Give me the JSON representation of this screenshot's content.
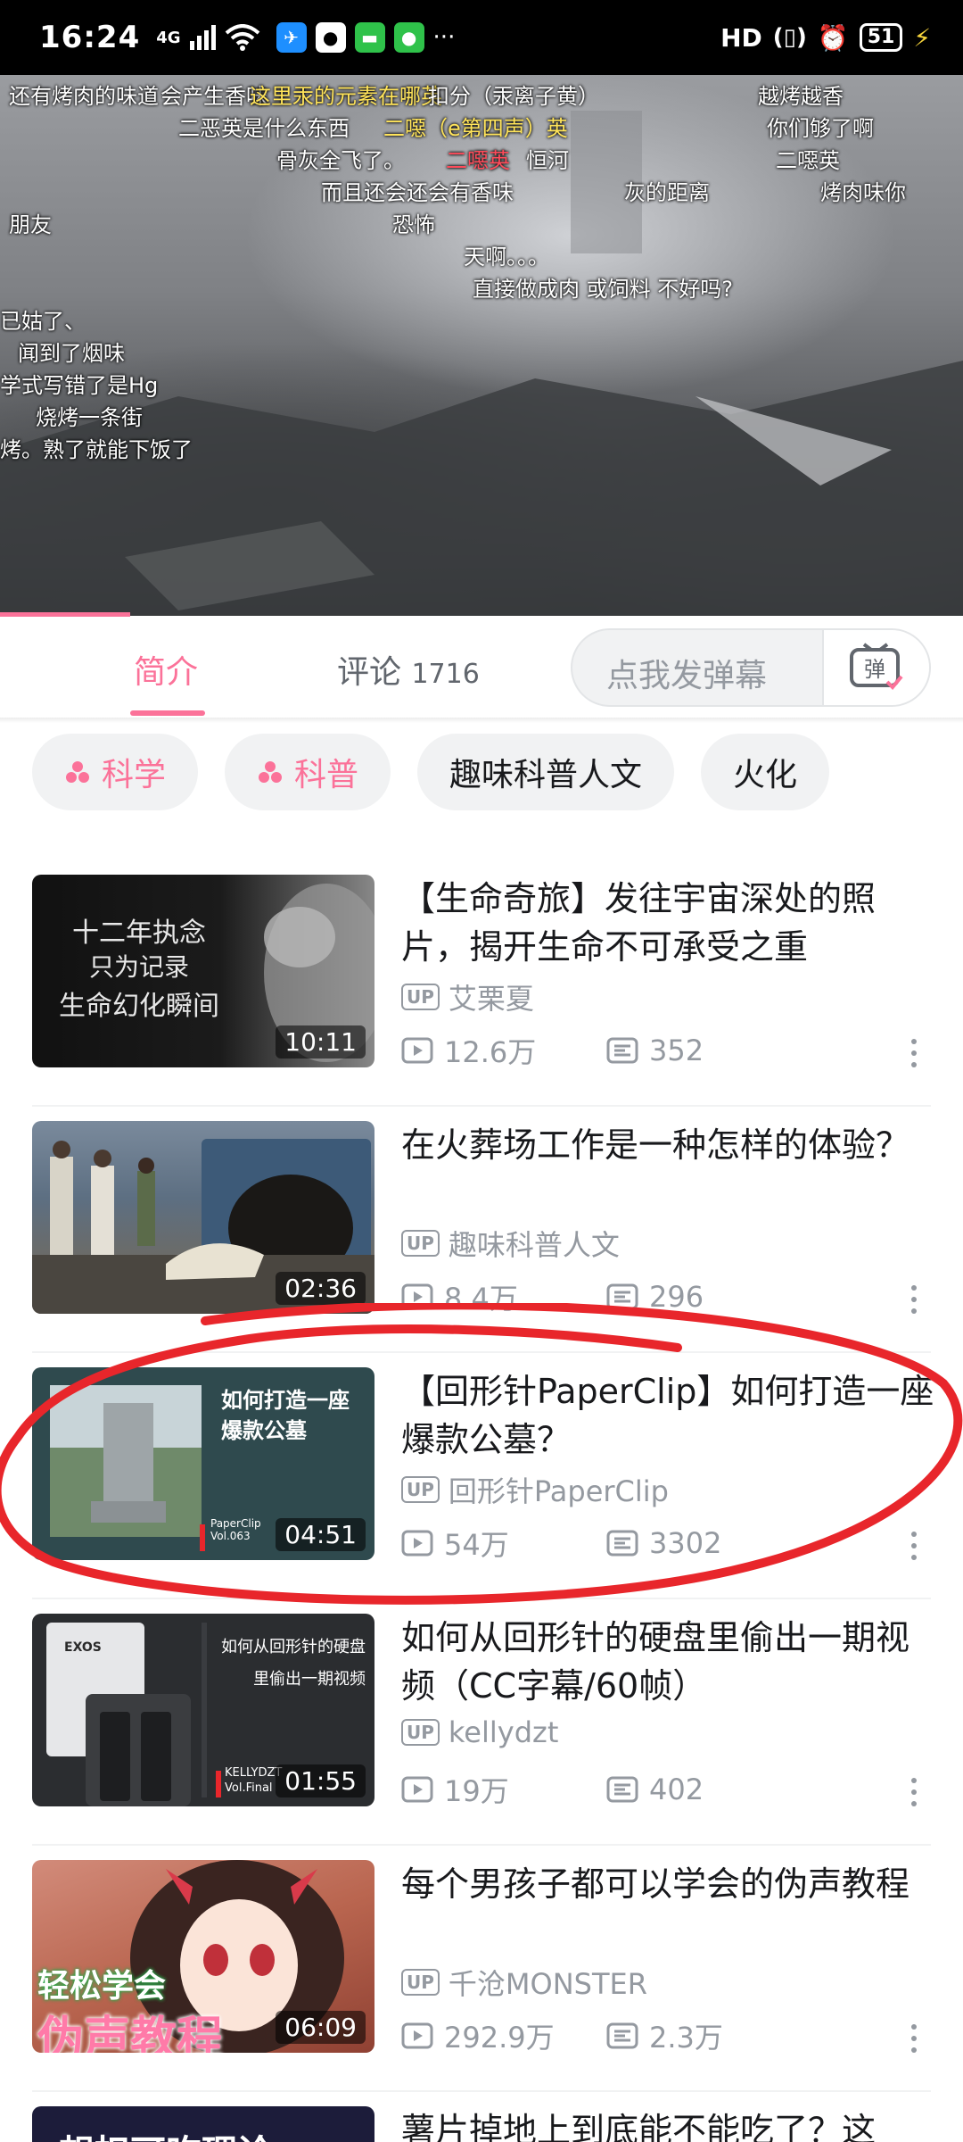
{
  "status_bar": {
    "time": "16:24",
    "network": "4G",
    "hd_label": "HD",
    "battery": "51",
    "more": "···"
  },
  "player": {
    "progress_fraction": 0.135,
    "danmaku": [
      "还有烤肉的味道",
      "会产生香味",
      "这里汞的元素在哪英",
      "扣分（汞离子黄）",
      "越烤越香",
      "二恶英是什么东西",
      "二噁（e第四声）英",
      "你们够了啊",
      "骨灰全飞了。",
      "二噁英",
      "恒河",
      "二噁英",
      "而且还会还会有香味",
      "灰的距离",
      "烤肉味你",
      "朋友",
      "恐怖",
      "天啊。。。",
      "直接做成肉 或饲料 不好吗?",
      "已姑了、",
      "闻到了烟味",
      "学式写错了是Hg",
      "烧烤一条街",
      "烤。熟了就能下饭了"
    ]
  },
  "tabs": {
    "intro": "简介",
    "comments_label": "评论",
    "comments_count": "1716",
    "danmaku_placeholder": "点我发弹幕",
    "danmaku_button": "弹"
  },
  "tags": [
    "科学",
    "科普",
    "趣味科普人文",
    "火化"
  ],
  "videos": [
    {
      "title": "【生命奇旅】发往宇宙深处的照片，揭开生命不可承受之重",
      "up": "艾栗夏",
      "views": "12.6万",
      "danmaku": "352",
      "duration": "10:11",
      "thumb_text": [
        "十二年执念",
        "只为记录",
        "生命幻化瞬间"
      ]
    },
    {
      "title": "在火葬场工作是一种怎样的体验？",
      "up": "趣味科普人文",
      "views": "8.4万",
      "danmaku": "296",
      "duration": "02:36"
    },
    {
      "title": "【回形针PaperClip】如何打造一座爆款公墓？",
      "up": "回形针PaperClip",
      "views": "54万",
      "danmaku": "3302",
      "duration": "04:51",
      "thumb_text": [
        "如何打造一座",
        "爆款公墓",
        "PaperClip",
        "Vol.063"
      ]
    },
    {
      "title": "如何从回形针的硬盘里偷出一期视频（CC字幕/60帧）",
      "up": "kellydzt",
      "views": "19万",
      "danmaku": "402",
      "duration": "01:55",
      "thumb_text": [
        "如何从回形针的硬盘",
        "里偷出一期视频",
        "KELLYDZT",
        "Vol.Final",
        "EXOS"
      ]
    },
    {
      "title": "每个男孩子都可以学会的伪声教程",
      "up": "千沧MONSTER",
      "views": "292.9万",
      "danmaku": "2.3万",
      "duration": "06:09",
      "thumb_text": [
        "轻松学会",
        "伪声教程"
      ]
    }
  ],
  "partial_item": {
    "title": "薯片掉地上到底能不能吃了？这",
    "thumb_text": "想扣可吃理论"
  },
  "up_badge": "UP",
  "colors": {
    "accent": "#fb7299",
    "annotation": "#e8262b"
  },
  "icons": {
    "play_count": "play-icon",
    "danmaku_count": "danmaku-icon",
    "more": "more-vertical-icon",
    "tag": "tag-icon"
  }
}
